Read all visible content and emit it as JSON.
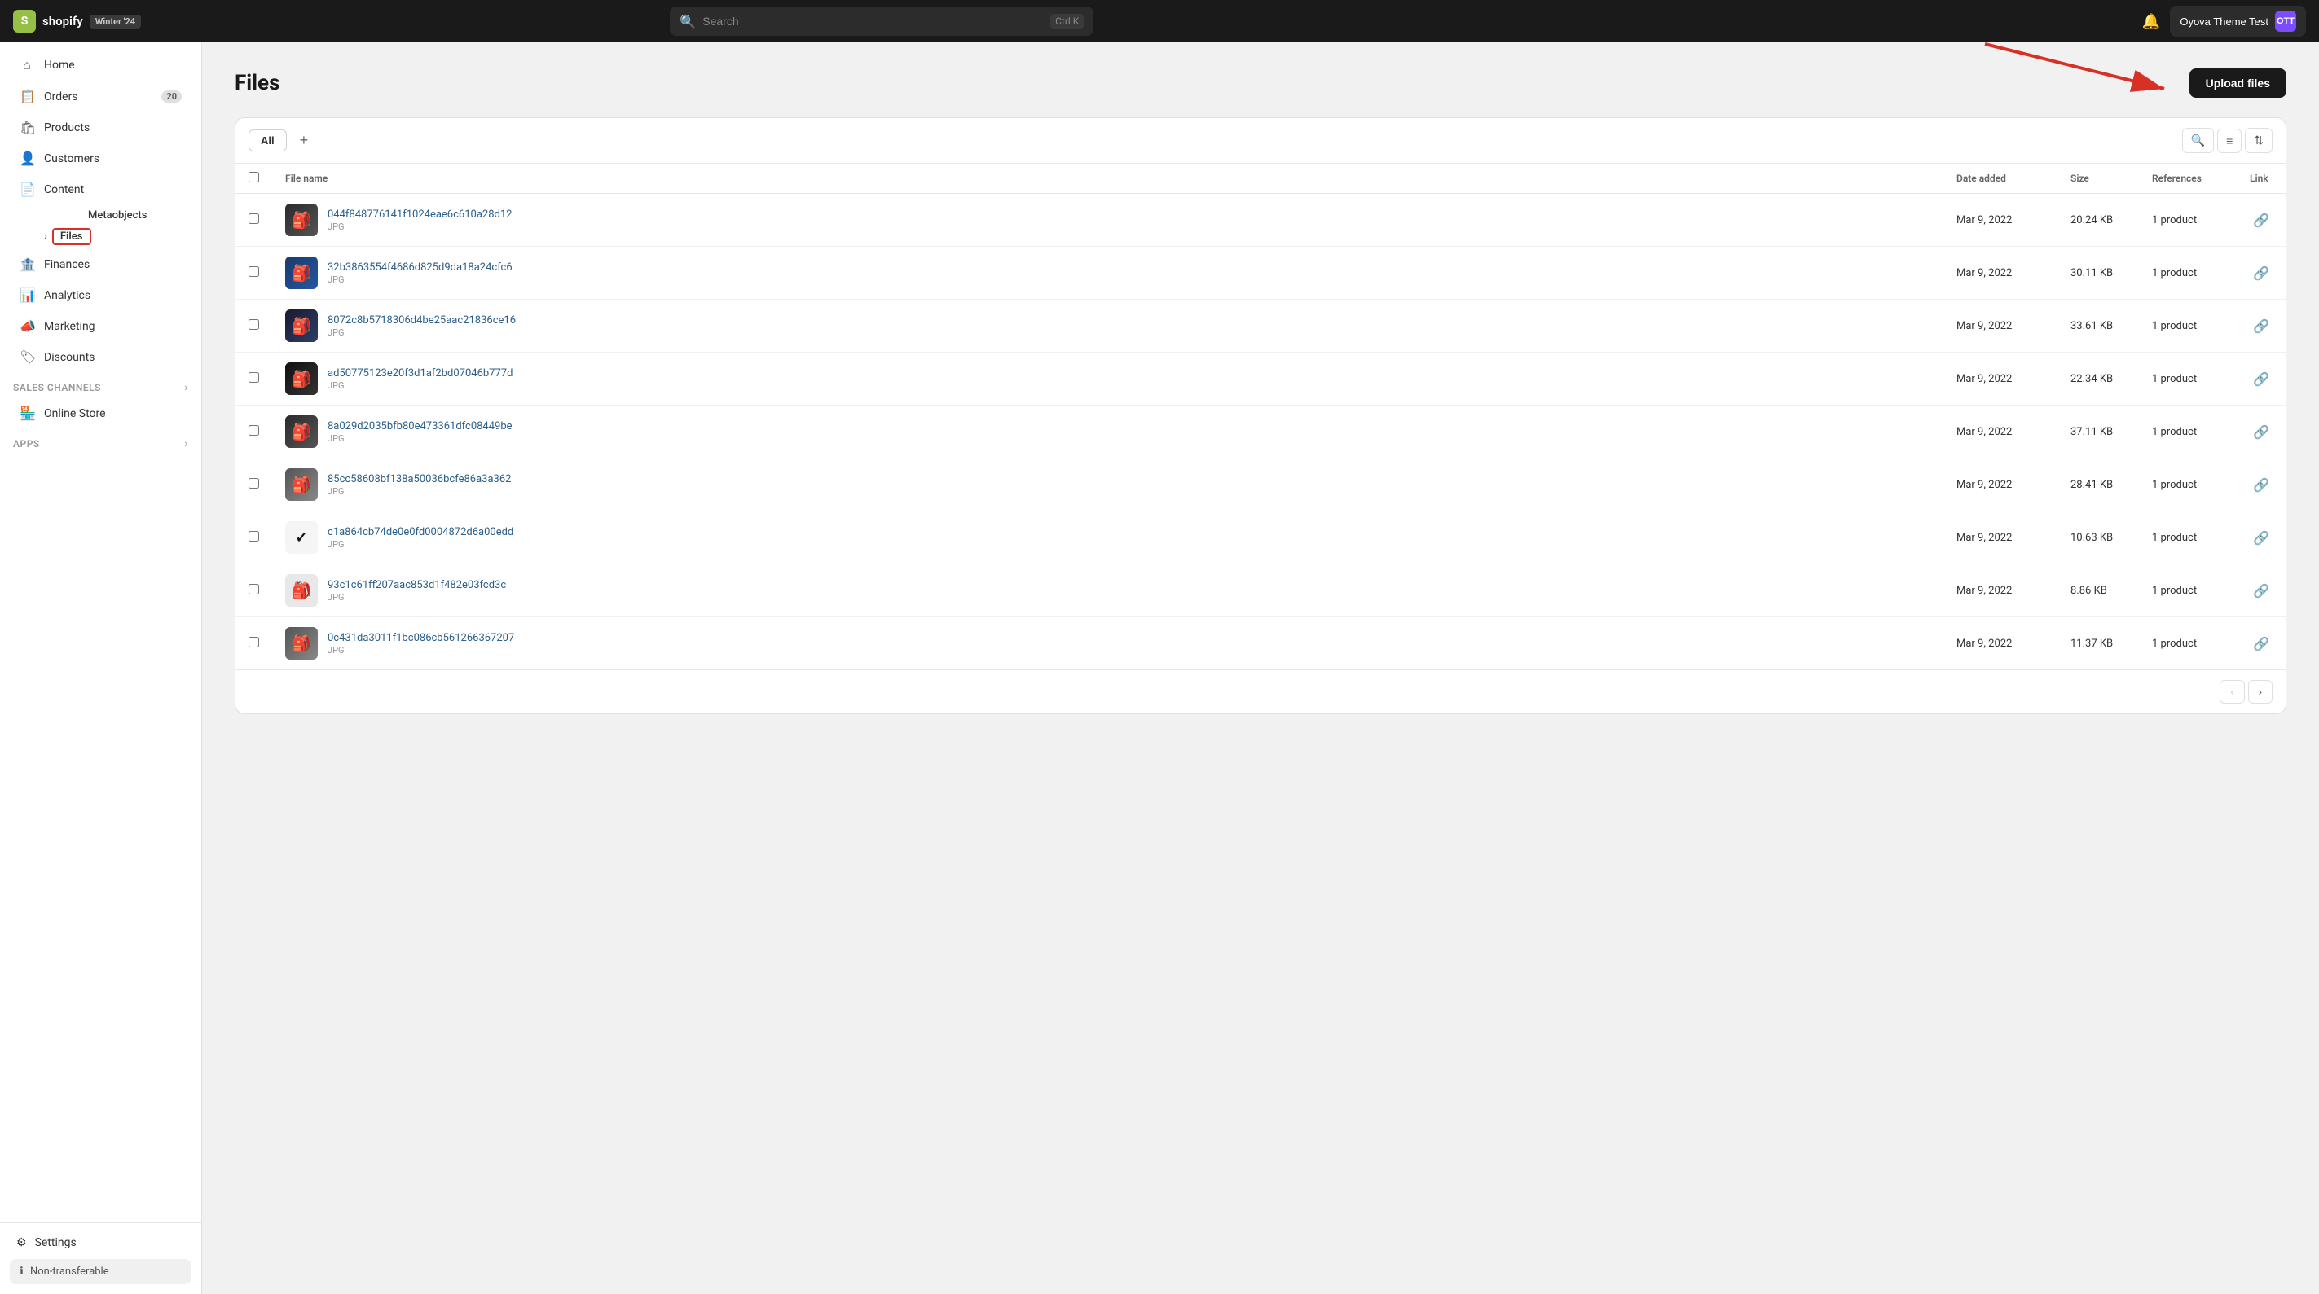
{
  "topnav": {
    "logo_text": "shopify",
    "badge": "Winter '24",
    "search_placeholder": "Search",
    "shortcut": "Ctrl K",
    "store_name": "Oyova Theme Test",
    "avatar_initials": "OTT"
  },
  "sidebar": {
    "items": [
      {
        "id": "home",
        "label": "Home",
        "icon": "🏠",
        "badge": null
      },
      {
        "id": "orders",
        "label": "Orders",
        "icon": "📋",
        "badge": "20"
      },
      {
        "id": "products",
        "label": "Products",
        "icon": "🛍️",
        "badge": null
      },
      {
        "id": "customers",
        "label": "Customers",
        "icon": "👤",
        "badge": null
      },
      {
        "id": "content",
        "label": "Content",
        "icon": "📄",
        "badge": null
      }
    ],
    "content_sub": [
      {
        "id": "metaobjects",
        "label": "Metaobjects"
      },
      {
        "id": "files",
        "label": "Files",
        "active": true
      }
    ],
    "items2": [
      {
        "id": "finances",
        "label": "Finances",
        "icon": "🏦",
        "badge": null
      },
      {
        "id": "analytics",
        "label": "Analytics",
        "icon": "📊",
        "badge": null
      },
      {
        "id": "marketing",
        "label": "Marketing",
        "icon": "📣",
        "badge": null
      },
      {
        "id": "discounts",
        "label": "Discounts",
        "icon": "🏷️",
        "badge": null
      }
    ],
    "sales_channels": {
      "label": "Sales channels",
      "items": [
        {
          "id": "online-store",
          "label": "Online Store",
          "icon": "🏪"
        }
      ]
    },
    "apps": {
      "label": "Apps"
    },
    "settings": "Settings",
    "non_transferable": "Non-transferable"
  },
  "page": {
    "title": "Files",
    "upload_button": "Upload files",
    "tab_all": "All",
    "tab_add": "+",
    "table": {
      "headers": {
        "filename": "File name",
        "date_added": "Date added",
        "size": "Size",
        "references": "References",
        "link": "Link"
      },
      "rows": [
        {
          "name": "044f848776141f1024eae6c610a28d12",
          "type": "JPG",
          "date": "Mar 9, 2022",
          "size": "20.24 KB",
          "refs": "1 product",
          "thumb": "dark"
        },
        {
          "name": "32b3863554f4686d825d9da18a24cfc6",
          "type": "JPG",
          "date": "Mar 9, 2022",
          "size": "30.11 KB",
          "refs": "1 product",
          "thumb": "blue"
        },
        {
          "name": "8072c8b5718306d4be25aac21836ce16",
          "type": "JPG",
          "date": "Mar 9, 2022",
          "size": "33.61 KB",
          "refs": "1 product",
          "thumb": "darkblue"
        },
        {
          "name": "ad50775123e20f3d1af2bd07046b777d",
          "type": "JPG",
          "date": "Mar 9, 2022",
          "size": "22.34 KB",
          "refs": "1 product",
          "thumb": "black"
        },
        {
          "name": "8a029d2035bfb80e473361dfc08449be",
          "type": "JPG",
          "date": "Mar 9, 2022",
          "size": "37.11 KB",
          "refs": "1 product",
          "thumb": "dark"
        },
        {
          "name": "85cc58608bf138a50036bcfe86a3a362",
          "type": "JPG",
          "date": "Mar 9, 2022",
          "size": "28.41 KB",
          "refs": "1 product",
          "thumb": "gray"
        },
        {
          "name": "c1a864cb74de0e0fd0004872d6a00edd",
          "type": "JPG",
          "date": "Mar 9, 2022",
          "size": "10.63 KB",
          "refs": "1 product",
          "thumb": "nike"
        },
        {
          "name": "93c1c61ff207aac853d1f482e03fcd3c",
          "type": "JPG",
          "date": "Mar 9, 2022",
          "size": "8.86 KB",
          "refs": "1 product",
          "thumb": "white"
        },
        {
          "name": "0c431da3011f1bc086cb561266367207",
          "type": "JPG",
          "date": "Mar 9, 2022",
          "size": "11.37 KB",
          "refs": "1 product",
          "thumb": "gray"
        }
      ]
    }
  }
}
